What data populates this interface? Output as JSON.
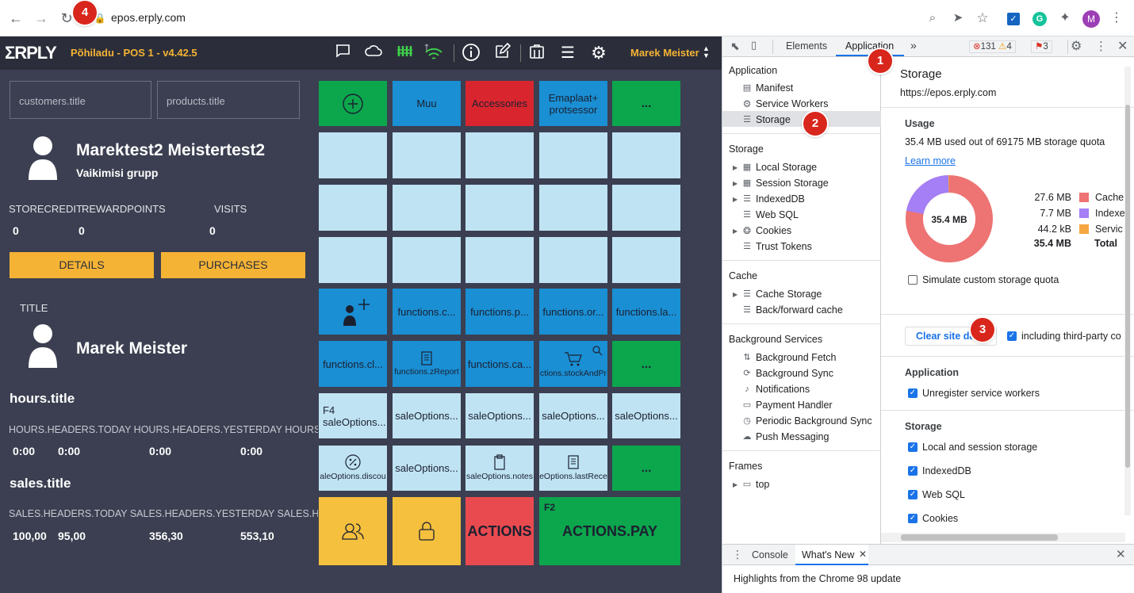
{
  "browser": {
    "url": "epos.erply.com",
    "badge_reload": "4"
  },
  "pos": {
    "logo": "ΣRPLY",
    "location": "Põhiladu - POS 1 - v4.42.5",
    "user": "Marek Meister",
    "customers_placeholder": "customers.title",
    "products_placeholder": "products.title",
    "customer_name": "Marektest2 Meistertest2",
    "customer_group": "Vaikimisi grupp",
    "stats": [
      {
        "label": "STORECREDIT",
        "value": "0"
      },
      {
        "label": "REWARDPOINTS",
        "value": "0"
      },
      {
        "label": "VISITS",
        "value": "0"
      }
    ],
    "details_label": "DETAILS",
    "purchases_label": "PURCHASES",
    "title_label": "TITLE",
    "employee_name": "Marek Meister",
    "hours_title": "hours.title",
    "hours_header": "HOURS.HEADERS.TODAY HOURS.HEADERS.YESTERDAY HOURS.HEADERS.WEEK HOURS.HEADERS",
    "hours_values": [
      "0:00",
      "0:00",
      "0:00",
      "0:00"
    ],
    "sales_title": "sales.title",
    "sales_header": "SALES.HEADERS.TODAY SALES.HEADERS.YESTERDAY SALES.HEADERS.WEEK SALES.HEADERS",
    "sales_values": [
      "100,00",
      "95,00",
      "356,30",
      "553,10"
    ],
    "tiles": {
      "muu": "Muu",
      "accessories": "Accessories",
      "emaplaat1": "Emaplaat+",
      "emaplaat2": "protsessor",
      "dots": "...",
      "f_c": "functions.c...",
      "f_p": "functions.p...",
      "f_or": "functions.or...",
      "f_la": "functions.la...",
      "f_cl": "functions.cl...",
      "f_zreport": "functions.zReport",
      "f_ca": "functions.ca...",
      "f_stock": "ctions.stockAndPr",
      "f4": "F4",
      "so1": "saleOptions...",
      "so_disc": "aleOptions.discou",
      "so_notes": "saleOptions.notes",
      "so_last": "eOptions.lastRece",
      "actions": "ACTIONS",
      "f2": "F2",
      "pay": "ACTIONS.PAY"
    }
  },
  "devtools": {
    "tabs": [
      "Elements",
      "Application"
    ],
    "more": "»",
    "errors": "131",
    "warnings": "4",
    "issues": "3",
    "sidebar": {
      "application_header": "Application",
      "application_items": [
        "Manifest",
        "Service Workers",
        "Storage"
      ],
      "storage_header": "Storage",
      "storage_items": [
        "Local Storage",
        "Session Storage",
        "IndexedDB",
        "Web SQL",
        "Cookies",
        "Trust Tokens"
      ],
      "cache_header": "Cache",
      "cache_items": [
        "Cache Storage",
        "Back/forward cache"
      ],
      "bg_header": "Background Services",
      "bg_items": [
        "Background Fetch",
        "Background Sync",
        "Notifications",
        "Payment Handler",
        "Periodic Background Sync",
        "Push Messaging"
      ],
      "frames_header": "Frames",
      "frames_items": [
        "top"
      ]
    },
    "main": {
      "title": "Storage",
      "origin": "https://epos.erply.com",
      "usage_header": "Usage",
      "usage_text": "35.4 MB used out of 69175 MB storage quota",
      "learn_more": "Learn more",
      "donut_center": "35.4 MB",
      "legend": [
        {
          "size": "27.6 MB",
          "name": "Cache",
          "color": "#ee7373"
        },
        {
          "size": "7.7 MB",
          "name": "Indexe",
          "color": "#a47ff5"
        },
        {
          "size": "44.2 kB",
          "name": "Servic",
          "color": "#f5a742"
        },
        {
          "size": "35.4 MB",
          "name": "Total",
          "color": ""
        }
      ],
      "usage_fractions": {
        "cache": 0.78,
        "indexeddb": 0.217,
        "service_workers": 0.003
      },
      "simulate_label": "Simulate custom storage quota",
      "clear_button": "Clear site data",
      "third_party_label": "including third-party co",
      "app_section": "Application",
      "unregister_label": "Unregister service workers",
      "storage_section": "Storage",
      "storage_checks": [
        "Local and session storage",
        "IndexedDB",
        "Web SQL",
        "Cookies"
      ]
    },
    "drawer": {
      "tabs": [
        "Console",
        "What's New"
      ],
      "highlight": "Highlights from the Chrome 98 update"
    }
  },
  "badges": [
    "1",
    "2",
    "3",
    "4"
  ]
}
